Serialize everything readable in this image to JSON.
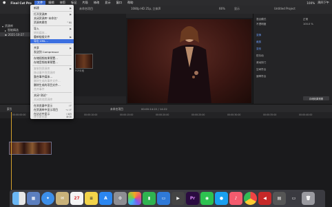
{
  "menubar": {
    "apple": "",
    "app_name": "Final Cut Pro",
    "items": [
      "文件",
      "编辑",
      "修剪",
      "标记",
      "片段",
      "修改",
      "显示",
      "窗口",
      "帮助"
    ],
    "right_status": "100%",
    "clock": "周四下午"
  },
  "library": {
    "rows": [
      "资源库",
      "智能精选",
      "2021-10-27"
    ]
  },
  "browser": {
    "clip_label": "FCP片段"
  },
  "viewer": {
    "title": "未命名项目",
    "format": "1080p HD 25p, 立体声",
    "zoom": "66%",
    "view_label": "显示"
  },
  "inspector": {
    "header": "Untitled Project",
    "rows": [
      "混合模式",
      "不透明度",
      "变换",
      "裁剪",
      "变形",
      "防抖动",
      "滚动快门",
      "空间符合",
      "速率符合"
    ],
    "values": [
      "正常",
      "100.0 %"
    ],
    "save_button": "存储效果预置"
  },
  "timeline": {
    "index_label": "索引",
    "project": "未命名项目",
    "timecode": "00:00:14:22 / 14:22",
    "ruler_marks": [
      "00:00:00:00",
      "00:00:05:00",
      "00:00:10:00",
      "00:00:15:00",
      "00:00:20:00",
      "00:00:25:00",
      "00:00:30:00",
      "00:00:35:00",
      "00:00:40:00"
    ]
  },
  "file_menu": {
    "items": [
      {
        "label": "新建",
        "arrow": "▶"
      },
      {
        "label": "打开资源库",
        "arrow": "▶"
      },
      {
        "label": "关闭资源库“未命名”"
      },
      {
        "label": "资源库属性",
        "sc": "^⌘J"
      },
      {
        "label": "导入",
        "arrow": "▶"
      },
      {
        "label": "转码媒体..."
      },
      {
        "label": "重新链接文件",
        "arrow": "▶"
      },
      {
        "label": "导出 XML..."
      },
      {
        "label": "共享",
        "arrow": "▶"
      },
      {
        "label": "发送到 Compressor"
      },
      {
        "label": "存储视频效果预置..."
      },
      {
        "label": "存储音频效果预置..."
      },
      {
        "label": "复制到资源库",
        "arrow": "▶"
      },
      {
        "label": "移动事件到资源库"
      },
      {
        "label": "整合事件媒体..."
      },
      {
        "label": "删除生成的事件文件..."
      },
      {
        "label": "删除生成的项目文件..."
      },
      {
        "label": "合并事件"
      },
      {
        "label": "关闭“测试”"
      },
      {
        "label": "关闭其他资源库"
      },
      {
        "label": "在浏览器中显示",
        "sc": "⇧F"
      },
      {
        "label": "在资源库中显示项目",
        "sc": "⌥⇧F"
      },
      {
        "label": "在访达中显示",
        "sc": "⇧⌘R"
      },
      {
        "label": "移到废纸篓",
        "sc": "⌘⌫"
      }
    ]
  },
  "dock": {
    "icons": [
      "finder-icon",
      "launchpad-icon",
      "safari-icon",
      "mail-icon",
      "calendar-icon",
      "notes-icon",
      "app-store-icon",
      "system-preferences-icon",
      "photos-icon",
      "numbers-icon",
      "keynote-icon",
      "final-cut-icon",
      "premiere-icon",
      "wechat-icon",
      "qq-icon",
      "music-icon",
      "chrome-icon",
      "tv-icon",
      "media-icon",
      "monitor-icon",
      "trash-icon"
    ],
    "premiere_label": "Pr"
  }
}
